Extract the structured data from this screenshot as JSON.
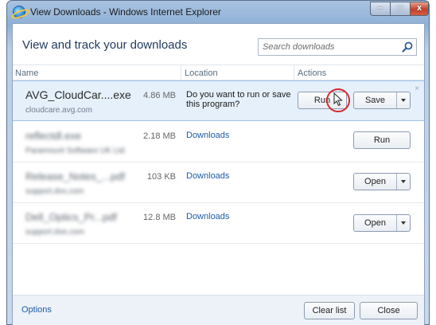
{
  "window": {
    "title": "View Downloads - Windows Internet Explorer",
    "controls": {
      "minimize": "",
      "maximize": "",
      "close": "x"
    }
  },
  "header": {
    "title": "View and track your downloads",
    "search_placeholder": "Search downloads"
  },
  "columns": {
    "name": "Name",
    "location": "Location",
    "actions": "Actions"
  },
  "downloads": [
    {
      "name": "AVG_CloudCar....exe",
      "source": "cloudcare.avg.com",
      "size": "4.86 MB",
      "location": "Do you want to run or save this program?",
      "actions": [
        "Run",
        "Save"
      ],
      "dismiss": "×"
    },
    {
      "name": "reflectdl.exe",
      "source": "Paramount Software UK Ltd",
      "size": "2.18 MB",
      "location": "Downloads",
      "actions": [
        "Run"
      ]
    },
    {
      "name": "Release_Notes_...pdf",
      "source": "support.dvx.com",
      "size": "103 KB",
      "location": "Downloads",
      "actions": [
        "Open"
      ]
    },
    {
      "name": "Dell_Optics_Pr...pdf",
      "source": "support.dve.com",
      "size": "12.8 MB",
      "location": "Downloads",
      "actions": [
        "Open"
      ]
    }
  ],
  "footer": {
    "options": "Options",
    "clear_list": "Clear list",
    "close": "Close"
  },
  "colors": {
    "accent": "#1c5ba8",
    "highlight_row": "#e5f0fb",
    "cursor_marker": "#d42a2a"
  }
}
